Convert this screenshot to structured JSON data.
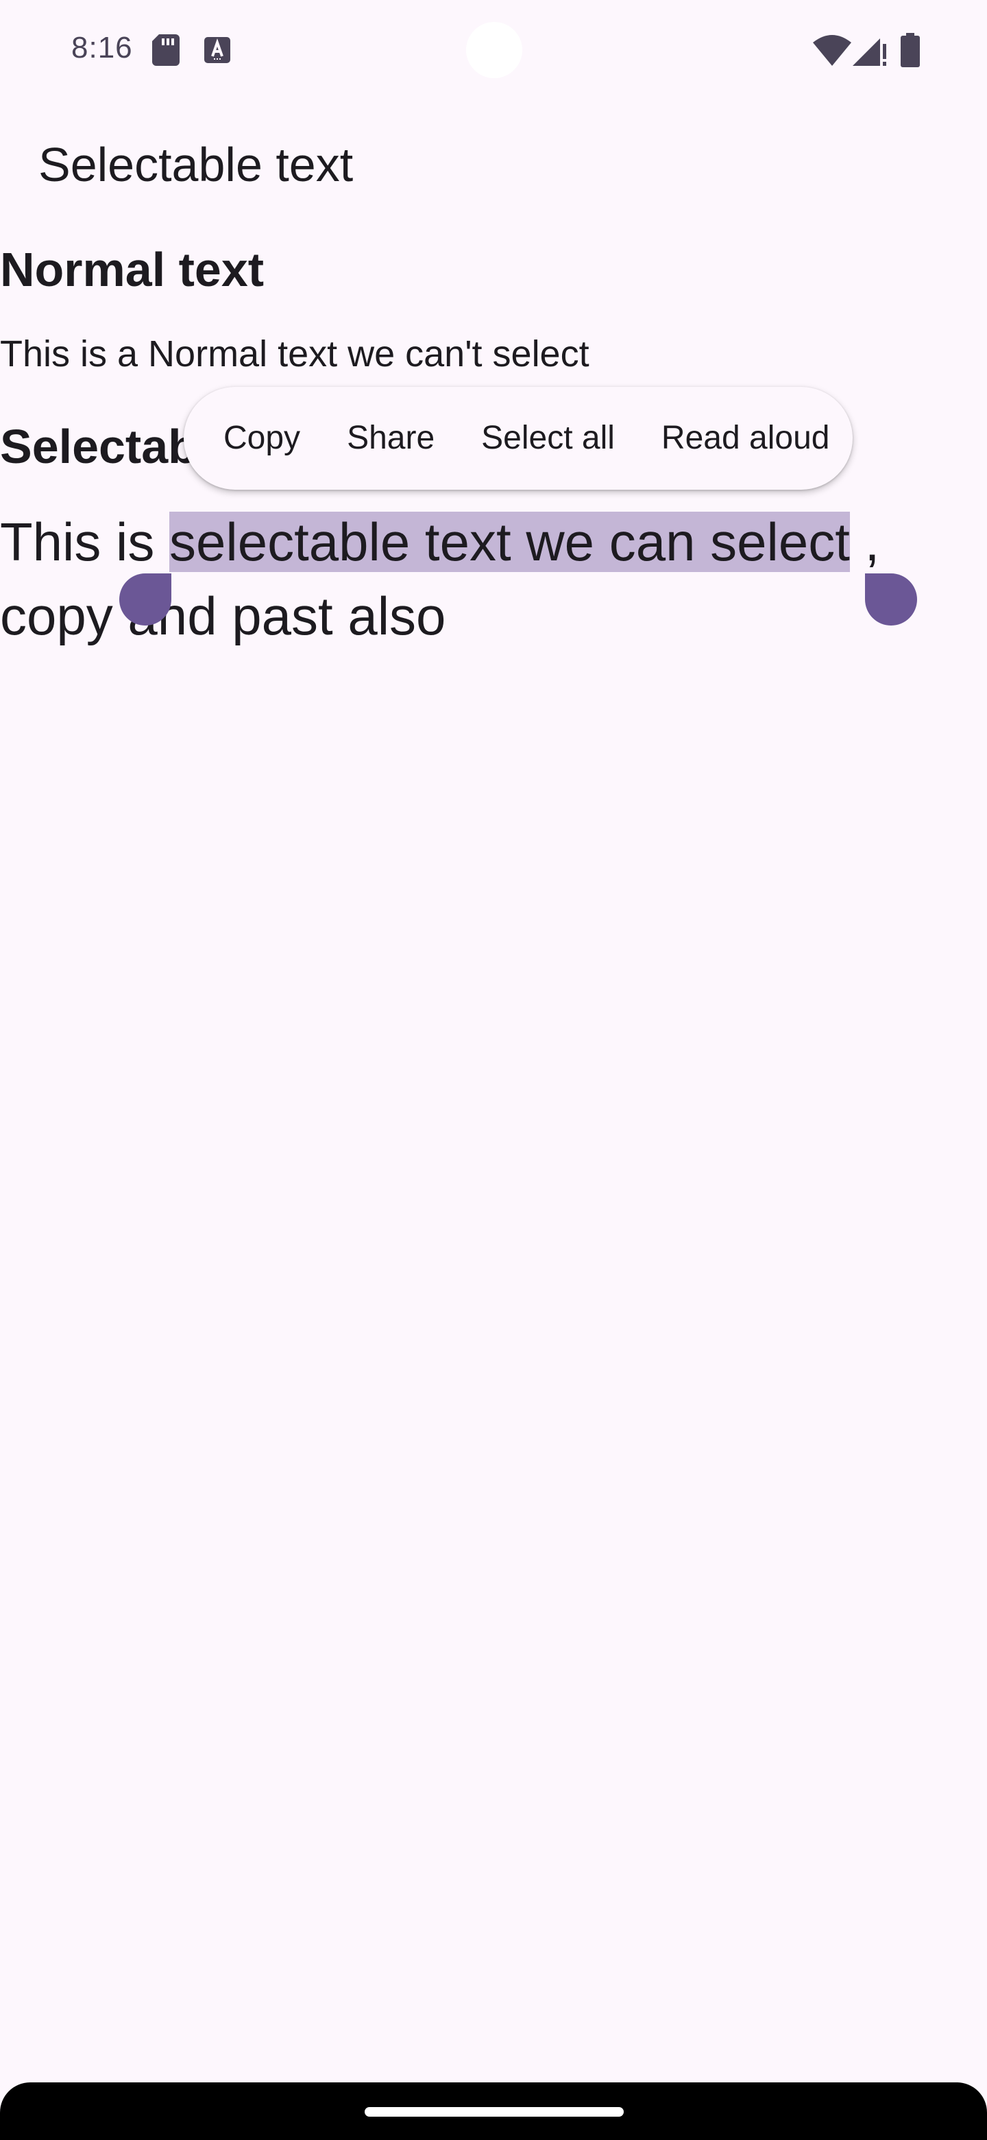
{
  "status_bar": {
    "time": "8:16",
    "icons": [
      "sd-card-icon",
      "text-a-icon",
      "wifi-icon",
      "cell-signal-icon",
      "battery-icon"
    ]
  },
  "app_bar": {
    "title": "Selectable text"
  },
  "content": {
    "normal_heading": "Normal text",
    "normal_body": "This is a Normal text we can't select",
    "selectable_heading": "Selectable text",
    "selectable_body": {
      "before_selection": "This is ",
      "selected": "selectable text we can select",
      "after_selection": " ,",
      "line2": "copy and past also"
    }
  },
  "text_toolbar": {
    "items": [
      "Copy",
      "Share",
      "Select all",
      "Read aloud"
    ]
  },
  "colors": {
    "background": "#fdf7fd",
    "selection": "#c4b6d6",
    "handle": "#6b5796",
    "text": "#1d1b20"
  }
}
